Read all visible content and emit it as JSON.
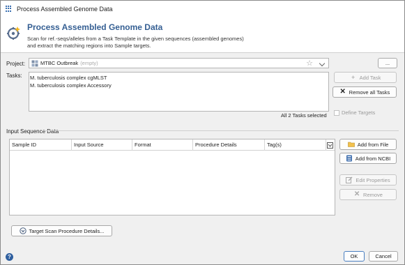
{
  "window": {
    "title": "Process Assembled Genome Data"
  },
  "header": {
    "title": "Process Assembled Genome Data",
    "description_line1": "Scan for ref.-seqs/alleles from a Task Template in the given sequences (assembled genomes)",
    "description_line2": "and extract the matching regions into Sample targets."
  },
  "project": {
    "label": "Project:",
    "value": "MTBC Outbreak",
    "empty_hint": "(empty)",
    "more_button": "..."
  },
  "tasks": {
    "label": "Tasks:",
    "items": [
      "M. tuberculosis complex cgMLST",
      "M. tuberculosis complex Accessory"
    ],
    "status": "All 2 Tasks selected",
    "add_task": "Add Task",
    "remove_all": "Remove all Tasks",
    "define_targets": "Define Targets"
  },
  "input": {
    "group_label": "Input Sequence Data",
    "columns": [
      "Sample ID",
      "Input Source",
      "Format",
      "Procedure Details",
      "Tag(s)"
    ],
    "add_from_file": "Add from File",
    "add_from_ncbi": "Add from NCBI",
    "edit_properties": "Edit Properties",
    "remove": "Remove"
  },
  "footer": {
    "target_scan": "Target Scan Procedure Details...",
    "ok": "OK",
    "cancel": "Cancel"
  },
  "colors": {
    "accent": "#355f93",
    "help": "#2f5f9f"
  }
}
